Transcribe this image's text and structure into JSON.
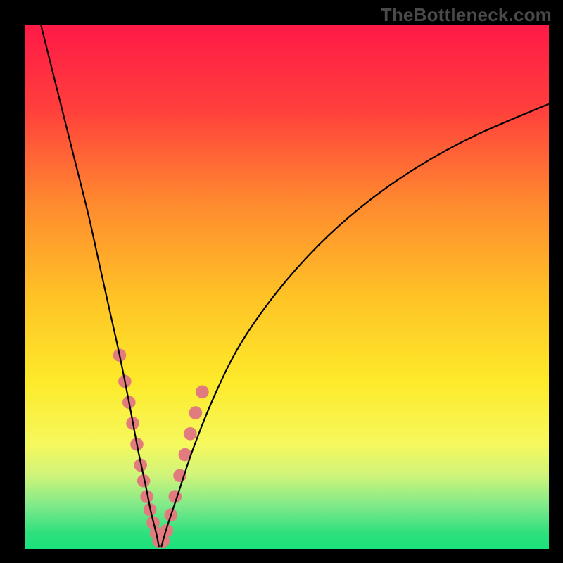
{
  "watermark": "TheBottleneck.com",
  "chart_data": {
    "type": "line",
    "title": "",
    "xlabel": "",
    "ylabel": "",
    "xlim": [
      0,
      100
    ],
    "ylim": [
      0,
      100
    ],
    "grid": false,
    "legend": false,
    "gradient_stops": [
      {
        "offset": 0.0,
        "color": "#ff1a47"
      },
      {
        "offset": 0.16,
        "color": "#ff3f3c"
      },
      {
        "offset": 0.34,
        "color": "#ff8a2f"
      },
      {
        "offset": 0.52,
        "color": "#ffc326"
      },
      {
        "offset": 0.68,
        "color": "#fdea2a"
      },
      {
        "offset": 0.8,
        "color": "#f6f85d"
      },
      {
        "offset": 0.86,
        "color": "#cff47a"
      },
      {
        "offset": 0.92,
        "color": "#7ce98a"
      },
      {
        "offset": 0.97,
        "color": "#2ee07d"
      },
      {
        "offset": 1.0,
        "color": "#19e27b"
      }
    ],
    "series": [
      {
        "name": "left-curve",
        "color": "#000000",
        "x": [
          3,
          6,
          9,
          12,
          14,
          16,
          18,
          20,
          21.5,
          23,
          24,
          25,
          25.5
        ],
        "y": [
          100,
          88,
          76,
          64,
          55,
          46,
          37,
          27,
          19,
          12,
          7,
          3,
          0.5
        ]
      },
      {
        "name": "right-curve",
        "color": "#000000",
        "x": [
          26,
          27,
          29,
          32,
          36,
          41,
          48,
          56,
          65,
          75,
          86,
          100
        ],
        "y": [
          0.5,
          4,
          10,
          19,
          29,
          39,
          49,
          58,
          66,
          73,
          79,
          85
        ]
      }
    ],
    "markers": {
      "name": "highlight-points",
      "color": "#e17b7d",
      "radius_pct": 1.25,
      "points": [
        {
          "x": 18.0,
          "y": 37.0
        },
        {
          "x": 19.0,
          "y": 32.0
        },
        {
          "x": 19.8,
          "y": 28.0
        },
        {
          "x": 20.5,
          "y": 24.0
        },
        {
          "x": 21.3,
          "y": 20.0
        },
        {
          "x": 22.0,
          "y": 16.0
        },
        {
          "x": 22.6,
          "y": 13.0
        },
        {
          "x": 23.2,
          "y": 10.0
        },
        {
          "x": 23.8,
          "y": 7.5
        },
        {
          "x": 24.4,
          "y": 5.0
        },
        {
          "x": 25.0,
          "y": 3.0
        },
        {
          "x": 25.5,
          "y": 1.5
        },
        {
          "x": 26.3,
          "y": 1.5
        },
        {
          "x": 27.0,
          "y": 3.5
        },
        {
          "x": 27.8,
          "y": 6.5
        },
        {
          "x": 28.6,
          "y": 10.0
        },
        {
          "x": 29.5,
          "y": 14.0
        },
        {
          "x": 30.5,
          "y": 18.0
        },
        {
          "x": 31.5,
          "y": 22.0
        },
        {
          "x": 32.5,
          "y": 26.0
        },
        {
          "x": 33.8,
          "y": 30.0
        }
      ]
    }
  }
}
